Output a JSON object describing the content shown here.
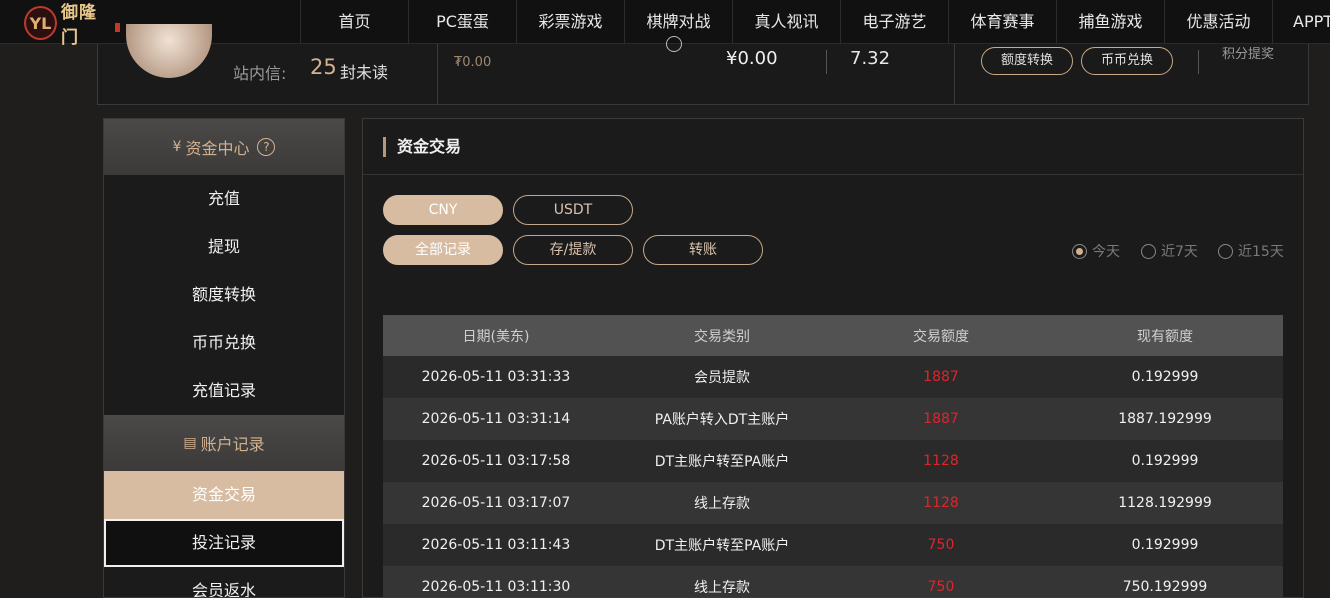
{
  "brand": {
    "logo_text": "御隆门",
    "logo_mark": "YL",
    "accent": "#d7bca2",
    "negative": "#e0242c"
  },
  "nav": {
    "items": [
      "首页",
      "PC蛋蛋",
      "彩票游戏",
      "棋牌对战",
      "真人视讯",
      "电子游艺",
      "体育赛事",
      "捕鱼游戏",
      "优惠活动",
      "APPT"
    ]
  },
  "user": {
    "msg_label": "站内信:",
    "msg_count": "25",
    "msg_unit": "封未读",
    "balance_small": "₮0.00",
    "wallet": "¥0.00",
    "points": "7.32",
    "transfer_btn": "额度转换",
    "exchange_btn": "币币兑换",
    "points_cut": "积分提奖"
  },
  "sidebar": {
    "fund_center": "资金中心",
    "fund_icon": "yen-coin-icon",
    "fund_items": [
      "充值",
      "提现",
      "额度转换",
      "币币兑换",
      "充值记录"
    ],
    "account_records": "账户记录",
    "account_icon": "document-icon",
    "record_items": [
      "资金交易",
      "投注记录",
      "会员返水"
    ],
    "active_item": "资金交易"
  },
  "panel": {
    "title": "资金交易",
    "currency_tabs": [
      "CNY",
      "USDT"
    ],
    "type_tabs": [
      "全部记录",
      "存/提款",
      "转账"
    ],
    "ranges": [
      "今天",
      "近7天",
      "近15天"
    ],
    "selected_range": "今天",
    "columns": [
      "日期(美东)",
      "交易类别",
      "交易额度",
      "现有额度"
    ],
    "rows": [
      [
        "2026-05-11 03:31:33",
        "会员提款",
        "1887",
        "0.192999"
      ],
      [
        "2026-05-11 03:31:14",
        "PA账户转入DT主账户",
        "1887",
        "1887.192999"
      ],
      [
        "2026-05-11 03:17:58",
        "DT主账户转至PA账户",
        "1128",
        "0.192999"
      ],
      [
        "2026-05-11 03:17:07",
        "线上存款",
        "1128",
        "1128.192999"
      ],
      [
        "2026-05-11 03:11:43",
        "DT主账户转至PA账户",
        "750",
        "0.192999"
      ],
      [
        "2026-05-11 03:11:30",
        "线上存款",
        "750",
        "750.192999"
      ]
    ]
  }
}
